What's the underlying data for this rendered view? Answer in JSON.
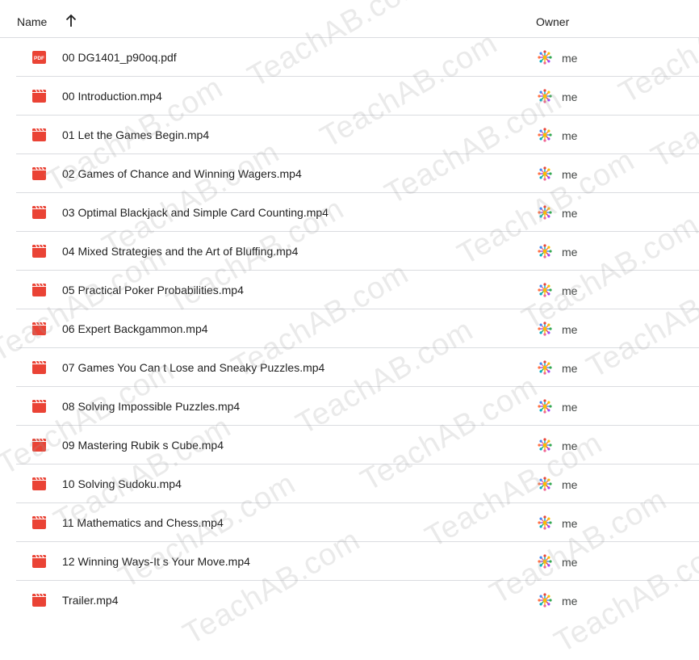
{
  "header": {
    "name_label": "Name",
    "owner_label": "Owner",
    "sort_icon": "arrow-up-icon"
  },
  "files": [
    {
      "name": "00 DG1401_p90oq.pdf",
      "type": "pdf",
      "owner": "me"
    },
    {
      "name": "00 Introduction.mp4",
      "type": "video",
      "owner": "me"
    },
    {
      "name": "01 Let the Games Begin.mp4",
      "type": "video",
      "owner": "me"
    },
    {
      "name": "02 Games of Chance and Winning Wagers.mp4",
      "type": "video",
      "owner": "me"
    },
    {
      "name": "03 Optimal Blackjack and Simple Card Counting.mp4",
      "type": "video",
      "owner": "me"
    },
    {
      "name": "04 Mixed Strategies and the Art of Bluffing.mp4",
      "type": "video",
      "owner": "me"
    },
    {
      "name": "05 Practical Poker Probabilities.mp4",
      "type": "video",
      "owner": "me"
    },
    {
      "name": "06 Expert Backgammon.mp4",
      "type": "video",
      "owner": "me"
    },
    {
      "name": "07 Games You Can t Lose and Sneaky Puzzles.mp4",
      "type": "video",
      "owner": "me"
    },
    {
      "name": "08 Solving Impossible Puzzles.mp4",
      "type": "video",
      "owner": "me"
    },
    {
      "name": "09 Mastering Rubik s Cube.mp4",
      "type": "video",
      "owner": "me"
    },
    {
      "name": "10 Solving Sudoku.mp4",
      "type": "video",
      "owner": "me"
    },
    {
      "name": "11 Mathematics and Chess.mp4",
      "type": "video",
      "owner": "me"
    },
    {
      "name": "12 Winning Ways-It s Your Move.mp4",
      "type": "video",
      "owner": "me"
    },
    {
      "name": "Trailer.mp4",
      "type": "video",
      "owner": "me"
    }
  ],
  "watermark_text": "TeachAB.com",
  "colors": {
    "file_icon_red": "#ea4335",
    "divider": "#dadce0",
    "text": "#1f1f1f"
  }
}
